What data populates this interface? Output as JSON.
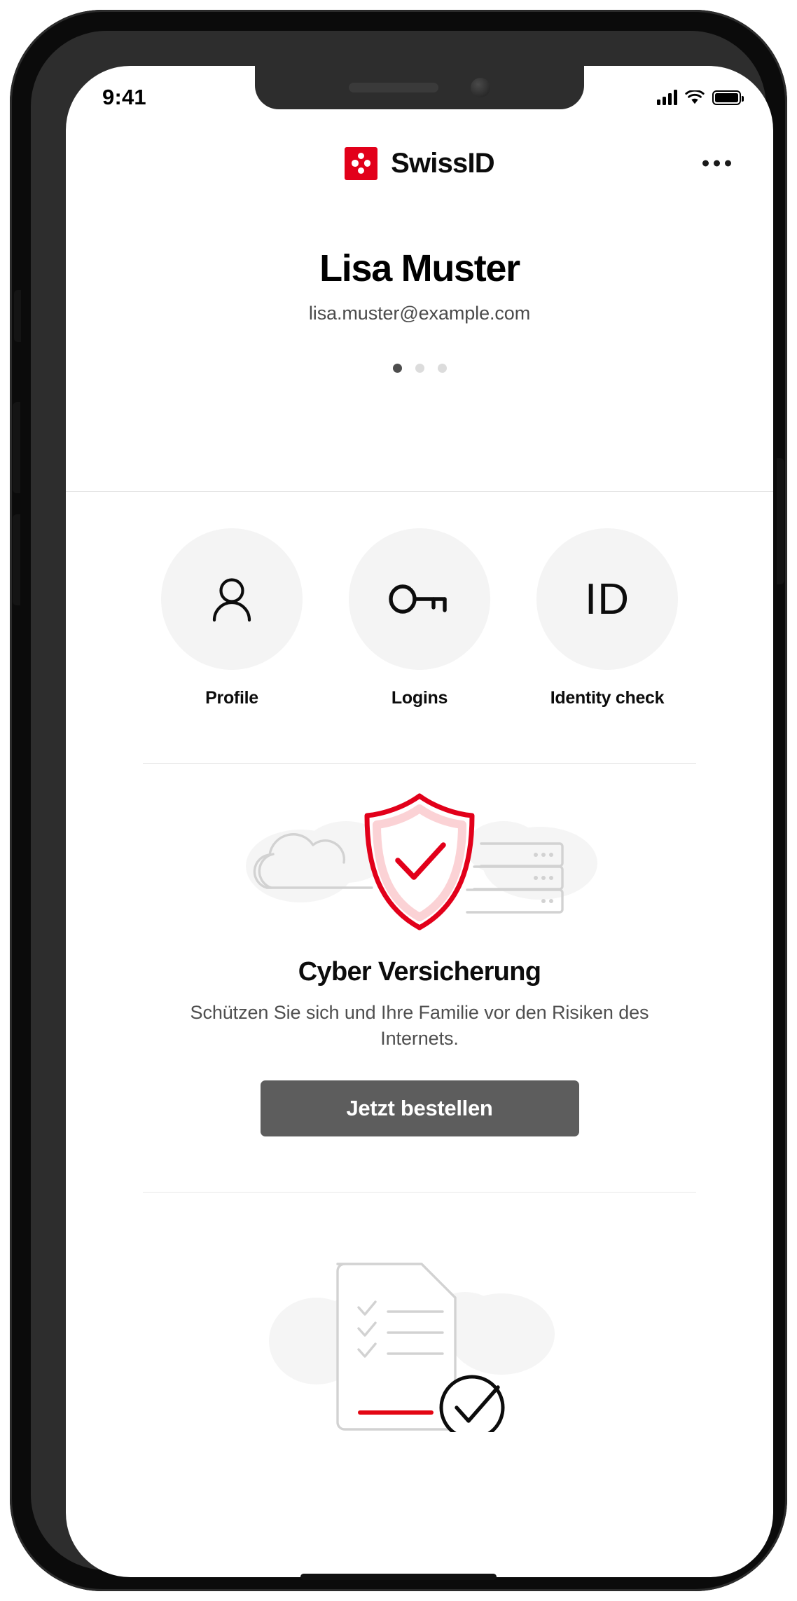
{
  "status_bar": {
    "time": "9:41",
    "signal_icon": "cellular-signal-icon",
    "wifi_icon": "wifi-icon",
    "battery_icon": "battery-full-icon"
  },
  "header": {
    "brand_name": "SwissID",
    "brand_mark_icon": "swissid-logo-icon",
    "more_icon": "more-options-icon",
    "brand_red": "#e2001a"
  },
  "profile": {
    "name": "Lisa Muster",
    "email": "lisa.muster@example.com",
    "carousel": {
      "total": 3,
      "active_index": 0
    }
  },
  "quick_actions": [
    {
      "label": "Profile",
      "icon": "person-icon"
    },
    {
      "label": "Logins",
      "icon": "key-icon"
    },
    {
      "label": "Identity check",
      "icon": "id-icon",
      "icon_text": "ID"
    }
  ],
  "promo_cyber": {
    "illustration_icon": "shield-check-cloud-server-icon",
    "title": "Cyber Versicherung",
    "description": "Schützen Sie sich und Ihre Familie vor den Risiken des Internets.",
    "cta_label": "Jetzt bestellen",
    "cta_color": "#5d5d5d",
    "accent_color": "#e2001a"
  },
  "promo_secondary": {
    "illustration_icon": "document-checklist-verified-icon",
    "accent_color": "#e30613"
  }
}
